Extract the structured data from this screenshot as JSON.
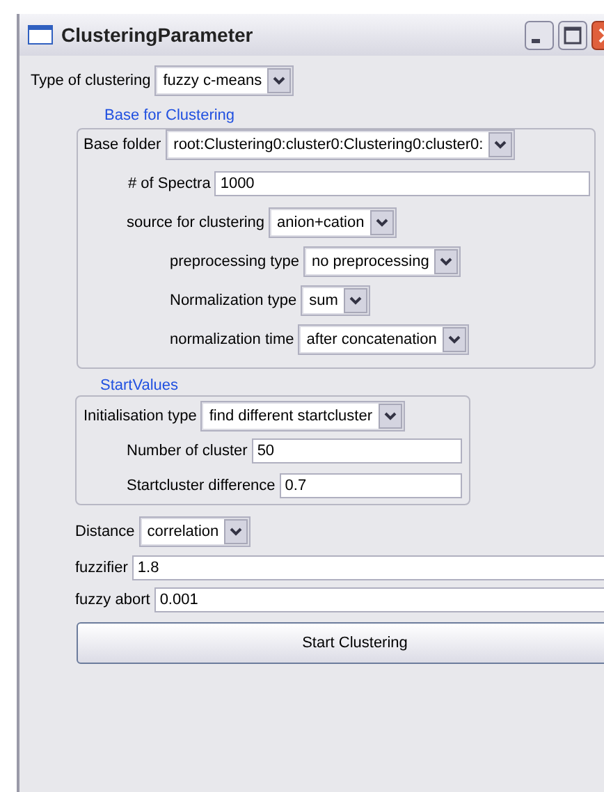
{
  "window": {
    "title": "ClusteringParameter"
  },
  "clustering_type": {
    "kind": "dropdown",
    "label": "Type of clustering",
    "value": "fuzzy c-means"
  },
  "base_group": {
    "title": "Base for Clustering",
    "rows": [
      {
        "kind": "dropdown",
        "label": "Base folder",
        "value": "root:Clustering0:cluster0:Clustering0:cluster0:"
      },
      {
        "kind": "text",
        "label": "# of Spectra",
        "value": "1000"
      },
      {
        "kind": "dropdown",
        "label": "source for clustering",
        "value": "anion+cation"
      },
      {
        "kind": "dropdown",
        "label": "preprocessing type",
        "value": "no preprocessing"
      },
      {
        "kind": "dropdown",
        "label": "Normalization type",
        "value": "sum"
      },
      {
        "kind": "dropdown",
        "label": "normalization time",
        "value": "after concatenation"
      }
    ]
  },
  "start_values": {
    "title": "StartValues",
    "rows": [
      {
        "kind": "dropdown",
        "label": "Initialisation type",
        "value": "find different startcluster"
      },
      {
        "kind": "text",
        "label": "Number of cluster",
        "value": "50"
      },
      {
        "kind": "text",
        "label": "Startcluster difference",
        "value": "0.7"
      }
    ]
  },
  "rows": [
    {
      "kind": "dropdown",
      "label": "Distance",
      "value": "correlation"
    },
    {
      "kind": "text",
      "label": "fuzzifier",
      "value": "1.8"
    },
    {
      "kind": "text",
      "label": "fuzzy abort",
      "value": "0.001"
    }
  ],
  "start_button": {
    "label": "Start Clustering"
  }
}
